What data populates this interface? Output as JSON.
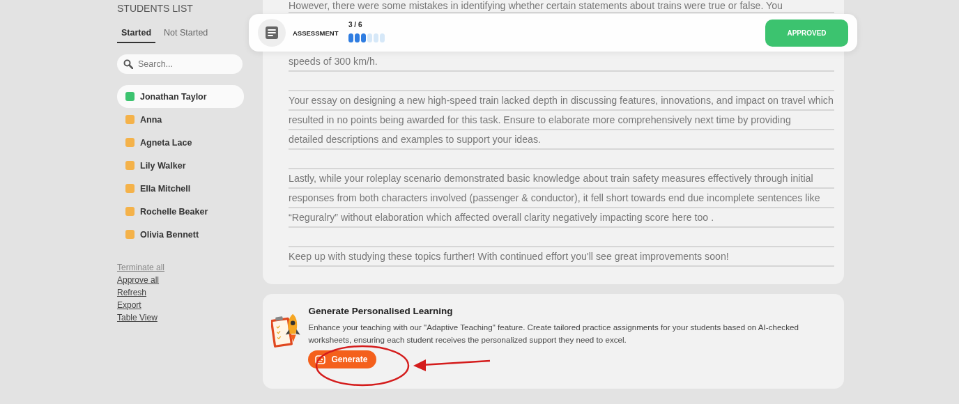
{
  "sidebar": {
    "title": "STUDENTS LIST",
    "tabs": [
      {
        "label": "Started",
        "selected": true
      },
      {
        "label": "Not Started",
        "selected": false
      }
    ],
    "search": {
      "placeholder": "Search..."
    },
    "students": [
      {
        "name": "Jonathan Taylor",
        "color": "#3cc36f",
        "selected": true
      },
      {
        "name": "Anna",
        "color": "#f4b24a",
        "selected": false
      },
      {
        "name": "Agneta Lace",
        "color": "#f4b24a",
        "selected": false
      },
      {
        "name": "Lily Walker",
        "color": "#f4b24a",
        "selected": false
      },
      {
        "name": "Ella Mitchell",
        "color": "#f4b24a",
        "selected": false
      },
      {
        "name": "Rochelle Beaker",
        "color": "#f4b24a",
        "selected": false
      },
      {
        "name": "Olivia Bennett",
        "color": "#f4b24a",
        "selected": false
      }
    ],
    "actions": [
      {
        "label": "Terminate all",
        "disabled": true
      },
      {
        "label": "Approve all",
        "disabled": false
      },
      {
        "label": "Refresh",
        "disabled": false
      },
      {
        "label": "Export",
        "disabled": false
      },
      {
        "label": "Table View",
        "disabled": false
      }
    ]
  },
  "header": {
    "label": "ASSESSMENT",
    "progress_text": "3 / 6",
    "steps": [
      {
        "completed": true
      },
      {
        "completed": true
      },
      {
        "completed": true
      },
      {
        "completed": false
      },
      {
        "completed": false
      },
      {
        "completed": false
      }
    ],
    "status_button": "APPROVED"
  },
  "feedback": {
    "top_line": "However, there were some mistakes in identifying whether certain statements about trains were true or false. You",
    "paragraphs": [
      [
        "speeds of 300 km/h."
      ],
      [
        "Your essay on designing a new high-speed train lacked depth in discussing features, innovations, and impact on travel which",
        "resulted in no points being awarded for this task. Ensure to elaborate more comprehensively next time by providing",
        "detailed descriptions and examples to support your ideas."
      ],
      [
        "Lastly, while your roleplay scenario demonstrated basic knowledge about train safety measures effectively through initial",
        "responses from both characters involved (passenger & conductor), it fell short towards end due incomplete sentences like",
        "“Reguralry” without elaboration which affected overall clarity negatively impacting score here too ."
      ],
      [
        "Keep up with studying these topics further! With continued effort you'll see great improvements soon!"
      ]
    ]
  },
  "promo": {
    "title": "Generate Personalised Learning",
    "description": "Enhance your teaching with our \"Adaptive Teaching\" feature. Create tailored practice assignments for your students based on AI-checked worksheets, ensuring each student receives the personalized support they need to excel.",
    "button": "Generate"
  }
}
